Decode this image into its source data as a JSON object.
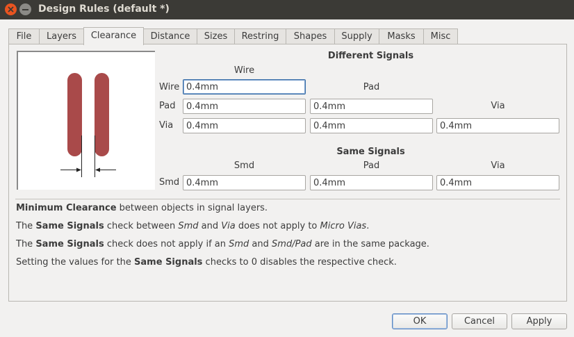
{
  "window": {
    "title": "Design Rules (default *)"
  },
  "tabs": [
    "File",
    "Layers",
    "Clearance",
    "Distance",
    "Sizes",
    "Restring",
    "Shapes",
    "Supply",
    "Masks",
    "Misc"
  ],
  "active_tab": "Clearance",
  "different_signals": {
    "heading": "Different Signals",
    "col_wire": "Wire",
    "col_pad": "Pad",
    "col_via": "Via",
    "row_wire": "Wire",
    "row_pad": "Pad",
    "row_via": "Via",
    "wire_wire": "0.4mm",
    "pad_wire": "0.4mm",
    "pad_pad": "0.4mm",
    "via_wire": "0.4mm",
    "via_pad": "0.4mm",
    "via_via": "0.4mm"
  },
  "same_signals": {
    "heading": "Same Signals",
    "col_smd": "Smd",
    "col_pad": "Pad",
    "col_via": "Via",
    "row_smd": "Smd",
    "smd_smd": "0.4mm",
    "smd_pad": "0.4mm",
    "smd_via": "0.4mm"
  },
  "notes": {
    "n1_b1": "Minimum Clearance",
    "n1_t1": " between objects in signal layers.",
    "n2_t1": "The ",
    "n2_b1": "Same Signals",
    "n2_t2": " check between ",
    "n2_i1": "Smd",
    "n2_t3": " and ",
    "n2_i2": "Via",
    "n2_t4": " does not apply to ",
    "n2_i3": "Micro Vias",
    "n2_t5": ".",
    "n3_t1": "The ",
    "n3_b1": "Same Signals",
    "n3_t2": " check does not apply if an ",
    "n3_i1": "Smd",
    "n3_t3": " and ",
    "n3_i2": "Smd/Pad",
    "n3_t4": " are in the same package.",
    "n4_t1": "Setting the values for the ",
    "n4_b1": "Same Signals",
    "n4_t2": " checks to 0 disables the respective check."
  },
  "buttons": {
    "ok": "OK",
    "cancel": "Cancel",
    "apply": "Apply"
  },
  "colors": {
    "accent": "#e95420",
    "trace": "#a94a4a",
    "titlebar": "#3b3a36"
  }
}
